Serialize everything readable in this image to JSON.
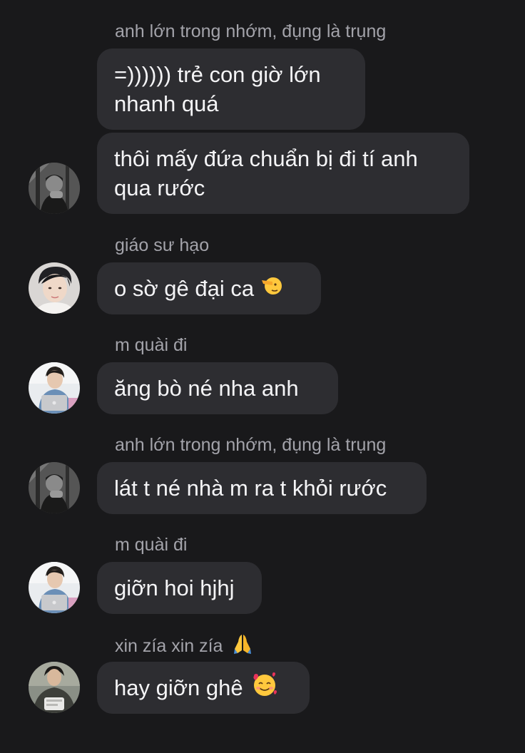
{
  "messages": [
    {
      "sender": "anh lớn trong nhớm, đụng là trụng",
      "lines": [
        "=)))))) trẻ con giờ lớn",
        "nhanh quá"
      ]
    },
    {
      "lines": [
        "thôi mấy đứa chuẩn bị đi tí anh",
        "qua rước"
      ]
    },
    {
      "sender": "giáo sư hạo",
      "text": "o sờ gê đại ca",
      "emoji": "saluting-face"
    },
    {
      "sender": "m quài đi",
      "text": "ăng bò né nha anh"
    },
    {
      "sender": "anh lớn trong nhớm, đụng là trụng",
      "text": "lát t né nhà m ra t khỏi rước"
    },
    {
      "sender": "m quài đi",
      "text": "giỡn hoi hjhj"
    },
    {
      "sender": "xin zía xin zía",
      "sender_emoji": "folded-hands",
      "text": "hay giỡn ghê",
      "emoji": "smiling-face-with-hearts"
    }
  ],
  "colors": {
    "background": "#19191b",
    "bubble": "#2d2d31",
    "sender_name": "#a3a3aa",
    "text": "#f4f4f6"
  }
}
